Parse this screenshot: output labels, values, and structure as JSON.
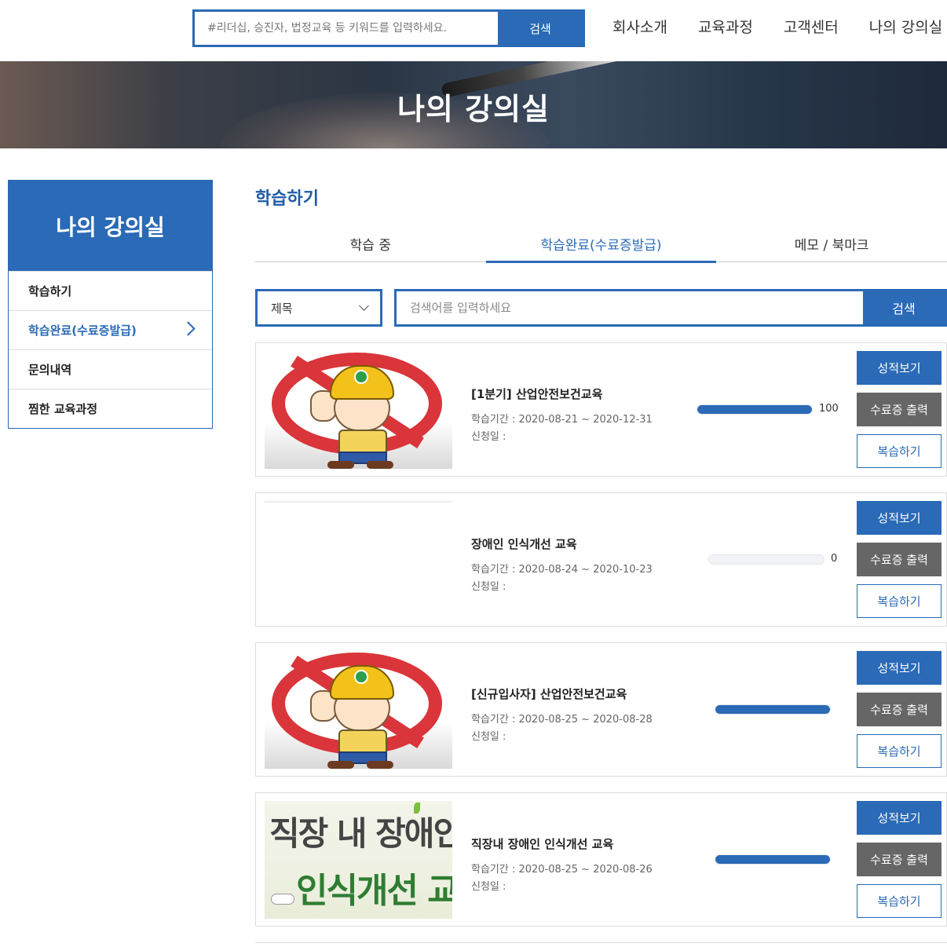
{
  "header": {
    "search_placeholder": "#리더십, 승진자, 법정교육 등 키워드를 입력하세요.",
    "search_button": "검색",
    "nav": [
      "회사소개",
      "교육과정",
      "고객센터",
      "나의 강의실"
    ]
  },
  "banner": {
    "title": "나의 강의실"
  },
  "sidebar": {
    "title": "나의 강의실",
    "items": [
      {
        "label": "학습하기",
        "active": false
      },
      {
        "label": "학습완료(수료증발급)",
        "active": true
      },
      {
        "label": "문의내역",
        "active": false
      },
      {
        "label": "찜한 교육과정",
        "active": false
      }
    ]
  },
  "main": {
    "title": "학습하기",
    "tabs": [
      "학습 중",
      "학습완료(수료증발급)",
      "메모 / 북마크"
    ],
    "active_tab": 1,
    "filter": {
      "select_value": "제목",
      "search_placeholder": "검색어를 입력하세요",
      "search_button": "검색"
    },
    "buttons": {
      "grade": "성적보기",
      "certificate": "수료증 출력",
      "review": "복습하기"
    },
    "courses": [
      {
        "title": "[1분기] 산업안전보건교육",
        "period": "학습기간 : 2020-08-21 ~ 2020-12-31",
        "applied": "신청일 :",
        "progress": 100,
        "progress_label": "100"
      },
      {
        "title": "장애인 인식개선 교육",
        "period": "학습기간 : 2020-08-24 ~ 2020-10-23",
        "applied": "신청일 :",
        "progress": 0,
        "progress_label": "0"
      },
      {
        "title": "[신규입사자] 산업안전보건교육",
        "period": "학습기간 : 2020-08-25 ~ 2020-08-28",
        "applied": "신청일 :",
        "progress": 100,
        "progress_label": ""
      },
      {
        "title": "직장내 장애인 인식개선 교육",
        "period": "학습기간 : 2020-08-25 ~ 2020-08-26",
        "applied": "신청일 :",
        "progress": 100,
        "progress_label": ""
      }
    ],
    "poster": {
      "line1": "직장 내 장애인",
      "line2": "인식개선 교육"
    }
  },
  "colors": {
    "accent": "#2a6ab6",
    "secondary_button": "#666666"
  }
}
